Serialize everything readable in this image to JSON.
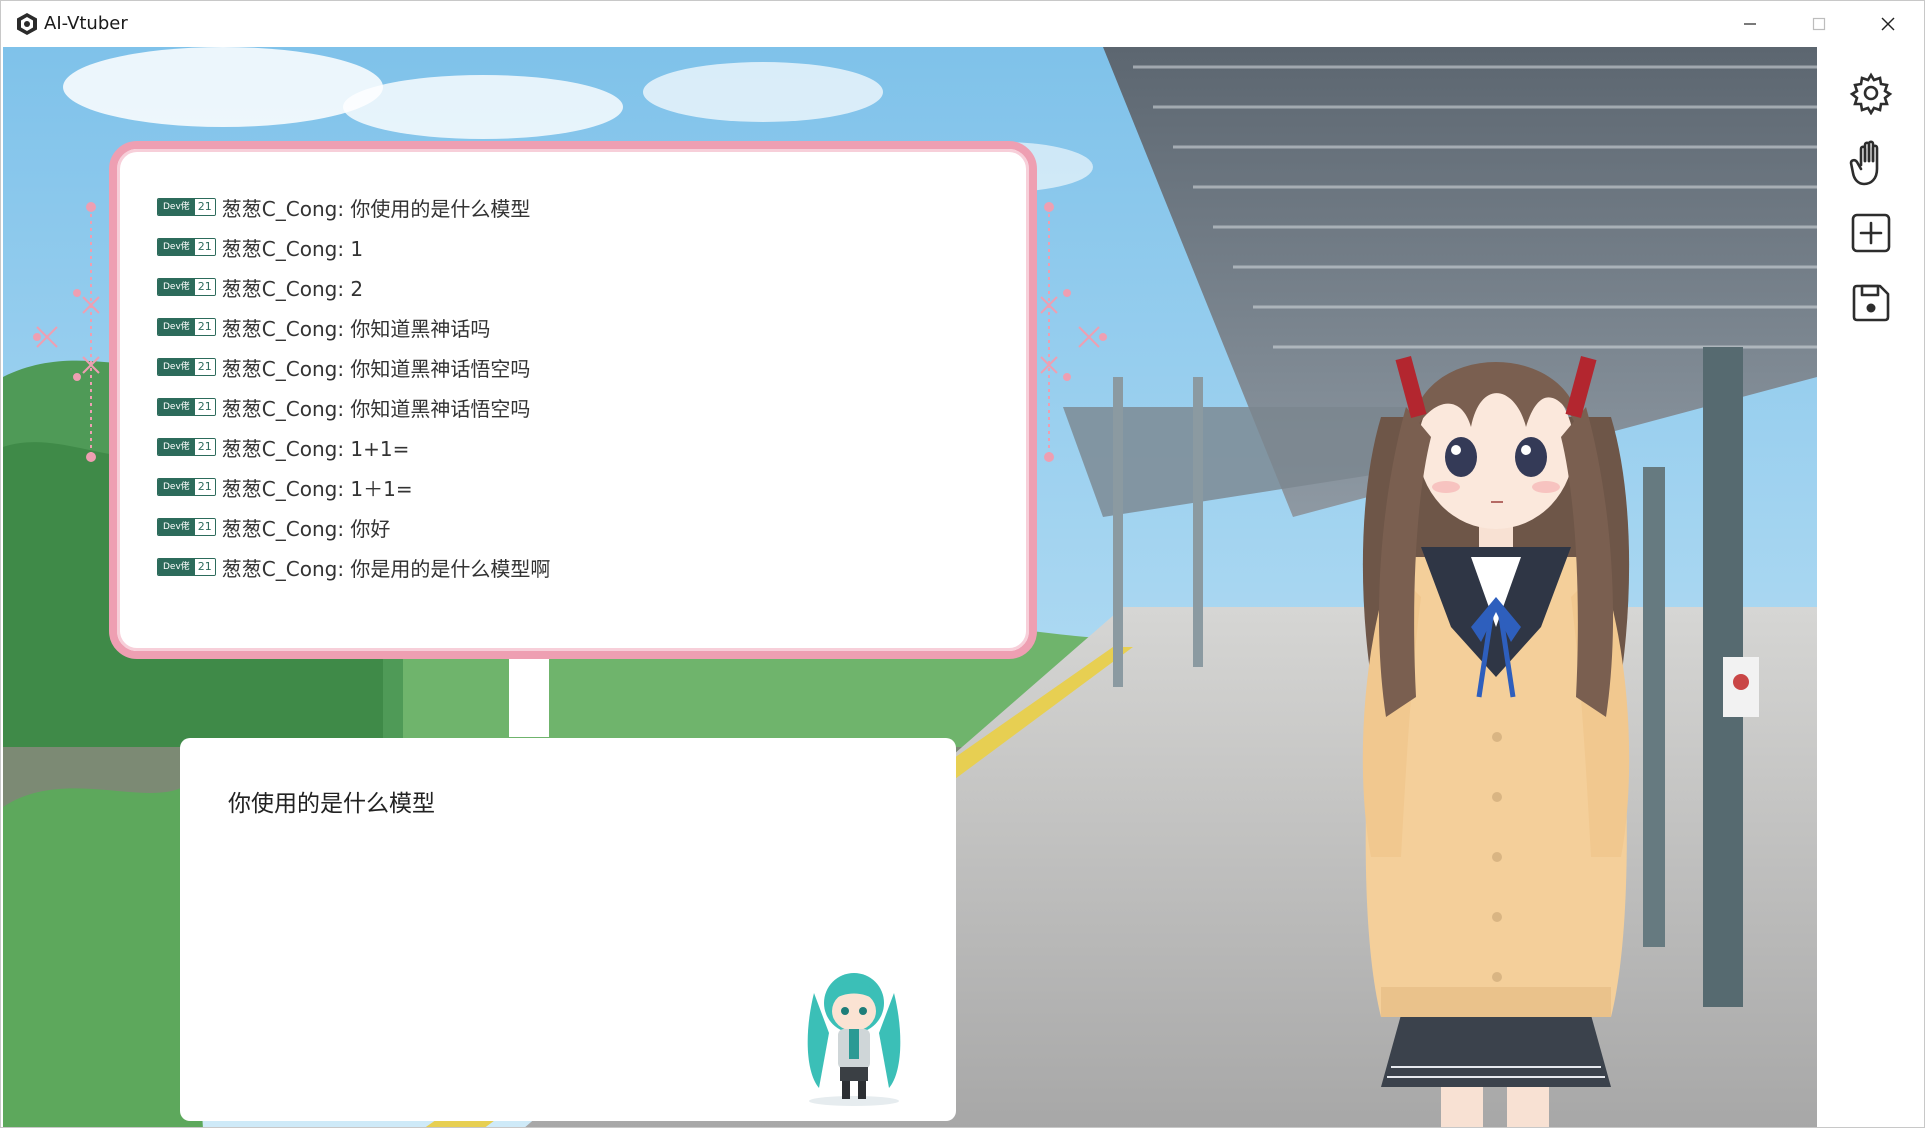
{
  "window": {
    "title": "AI-Vtuber",
    "controls": {
      "minimize": "minimize-icon",
      "maximize": "maximize-icon",
      "close": "close-icon"
    }
  },
  "toolbar": {
    "buttons": [
      {
        "icon": "gear-icon",
        "name": "settings"
      },
      {
        "icon": "hand-icon",
        "name": "interact"
      },
      {
        "icon": "plus-square-icon",
        "name": "add"
      },
      {
        "icon": "save-icon",
        "name": "save"
      }
    ]
  },
  "danmaku": {
    "medal_name": "Dev佬",
    "medal_level": "21",
    "items": [
      "葱葱C_Cong: 你使用的是什么模型",
      "葱葱C_Cong: 1",
      "葱葱C_Cong: 2",
      "葱葱C_Cong: 你知道黑神话吗",
      "葱葱C_Cong: 你知道黑神话悟空吗",
      "葱葱C_Cong: 你知道黑神话悟空吗",
      "葱葱C_Cong: 1+1=",
      "葱葱C_Cong: 1＋1=",
      "葱葱C_Cong: 你好",
      "葱葱C_Cong: 你是用的是什么模型啊"
    ]
  },
  "reply": {
    "text": "你使用的是什么模型"
  },
  "colors": {
    "panel_border": "#ee9fb2",
    "medal": "#2c6b5b",
    "sky": "#9fd3ef",
    "platform": "#b9b9b9"
  }
}
